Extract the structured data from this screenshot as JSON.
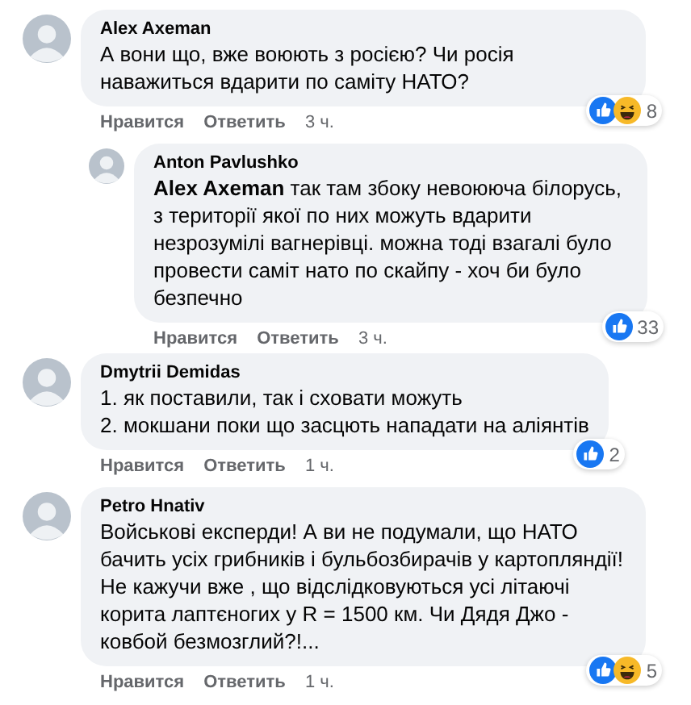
{
  "comments": [
    {
      "author": "Alex Axeman",
      "text": "А вони що, вже воюють з росією? Чи росія наважиться вдарити по саміту НАТО?",
      "reactions": [
        {
          "kind": "like"
        },
        {
          "kind": "haha"
        }
      ],
      "reaction_count": "8",
      "actions": [
        "Нравится",
        "Ответить"
      ],
      "time": "3 ч.",
      "children": [
        {
          "author": "Anton Pavlushko",
          "text": "**Alex Axeman** так там збоку невоююча білорусь, з території якої по них можуть вдарити незрозумілі вагнерівці. можна тоді взагалі було провести саміт нато по скайпу - хоч би було безпечно",
          "reactions": [
            {
              "kind": "like"
            }
          ],
          "reaction_count": "33",
          "actions": [
            "Нравится",
            "Ответить"
          ],
          "time": "3 ч."
        }
      ]
    },
    {
      "author": "Dmytrii Demidas",
      "text": "1. як поставили, так і сховати можуть\n2. мокшани поки що засцють нападати на аліянтів",
      "reactions": [
        {
          "kind": "like"
        }
      ],
      "reaction_count": "2",
      "actions": [
        "Нравится",
        "Ответить"
      ],
      "time": "1 ч."
    },
    {
      "author": "Petro Hnativ",
      "text": "Войськові експерди! А ви не подумали, що НАТО бачить усіх грибників і бульбозбирачів у картопляндії! Не кажучи вже , що відслідковуються усі літаючі корита лаптєногих у R = 1500 км. Чи Дядя Джо - ковбой безмозглий?!...",
      "reactions": [
        {
          "kind": "like"
        },
        {
          "kind": "haha"
        }
      ],
      "reaction_count": "5",
      "actions": [
        "Нравится",
        "Ответить"
      ],
      "time": "1 ч."
    }
  ]
}
